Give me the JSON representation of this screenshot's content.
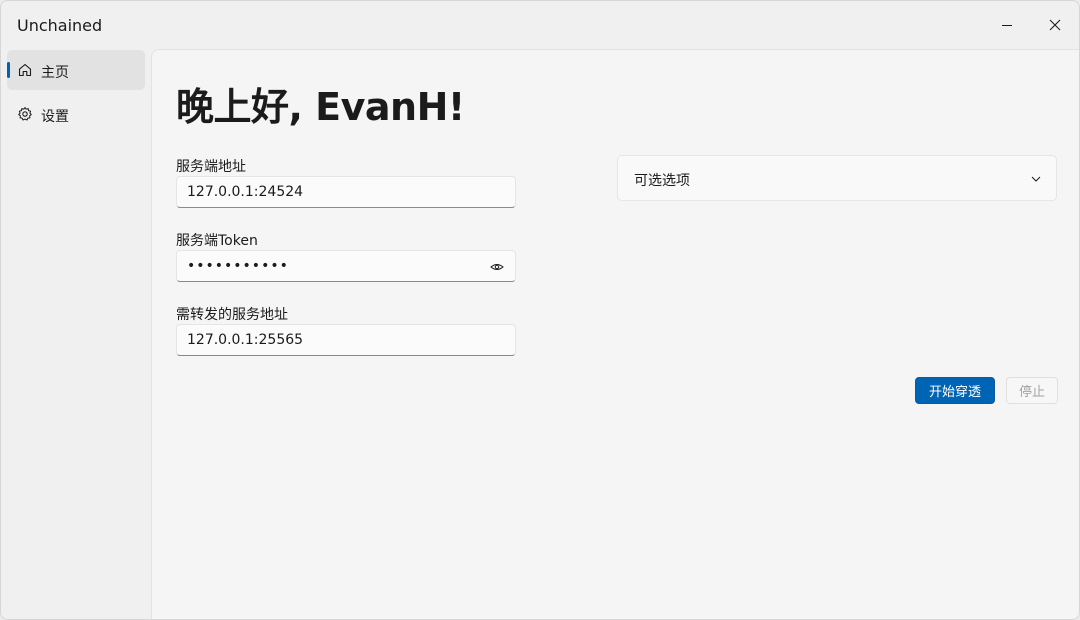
{
  "window": {
    "title": "Unchained",
    "minimize_icon": "minimize-icon",
    "close_icon": "close-icon"
  },
  "sidebar": {
    "items": [
      {
        "label": "主页",
        "icon": "home-icon",
        "active": true
      },
      {
        "label": "设置",
        "icon": "gear-icon",
        "active": false
      }
    ]
  },
  "main": {
    "greeting": "晚上好, EvanH!",
    "server_address": {
      "label": "服务端地址",
      "value": "127.0.0.1:24524"
    },
    "server_token": {
      "label": "服务端Token",
      "value": "•••••••••••",
      "reveal_icon": "eye-icon"
    },
    "forward_address": {
      "label": "需转发的服务地址",
      "value": "127.0.0.1:25565"
    },
    "options": {
      "label": "可选选项",
      "icon": "chevron-down-icon"
    },
    "start_button": "开始穿透",
    "stop_button": "停止"
  },
  "colors": {
    "accent": "#0064b5",
    "background": "#f5f5f5"
  }
}
